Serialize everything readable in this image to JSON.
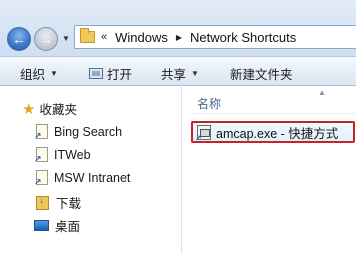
{
  "address_bar": {
    "breadcrumb_sep": "«",
    "crumbs": [
      "Windows",
      "Network Shortcuts"
    ]
  },
  "toolbar": {
    "organize_label": "组织",
    "open_label": "打开",
    "share_label": "共享",
    "new_folder_label": "新建文件夹"
  },
  "nav_pane": {
    "favorites_label": "收藏夹",
    "items": [
      {
        "label": "Bing Search",
        "icon": "shortcut-icon"
      },
      {
        "label": "ITWeb",
        "icon": "shortcut-icon"
      },
      {
        "label": "MSW Intranet",
        "icon": "shortcut-icon"
      },
      {
        "label": "下载",
        "icon": "download-folder-icon"
      },
      {
        "label": "桌面",
        "icon": "desktop-icon"
      }
    ]
  },
  "content": {
    "column_name": "名称",
    "files": [
      {
        "label": "amcap.exe - 快捷方式",
        "icon": "exe-shortcut-icon",
        "selected": true
      }
    ]
  },
  "colors": {
    "selection_border": "#c52424",
    "header_text": "#4b6a8e",
    "favorites_star": "#e5a520"
  }
}
